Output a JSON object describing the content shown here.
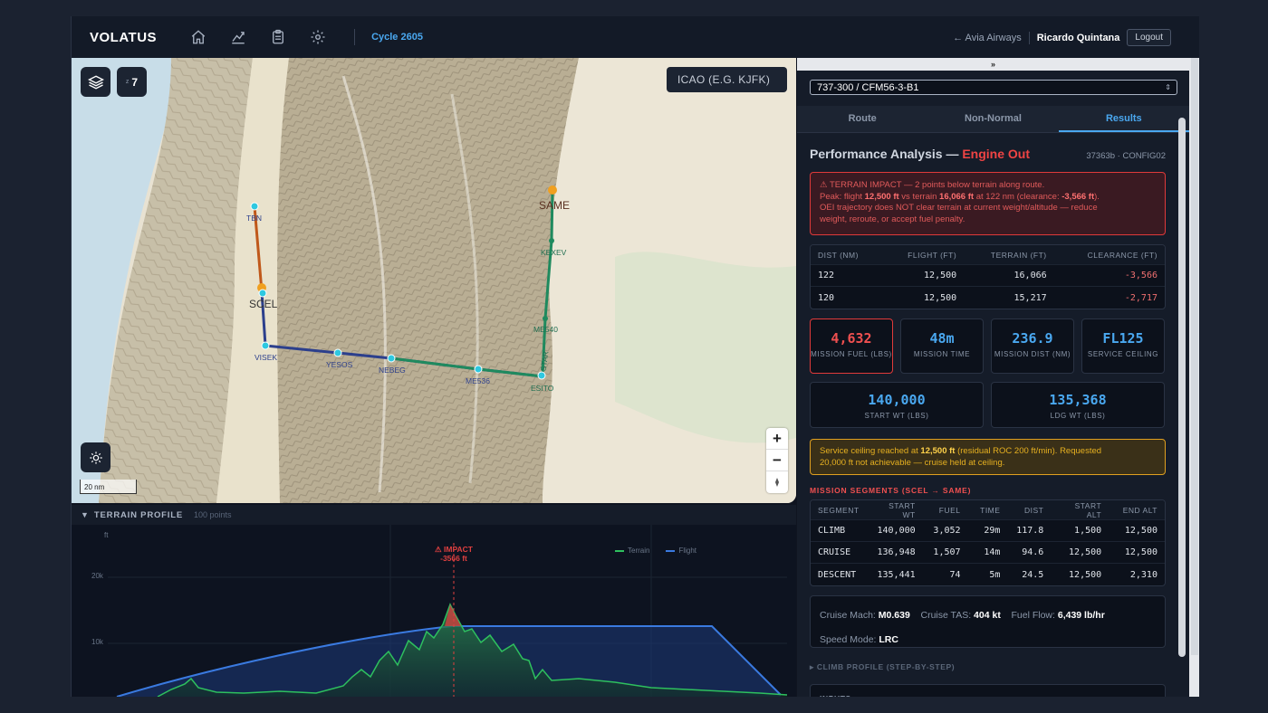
{
  "header": {
    "brand": "VOLATUS",
    "cycle": "Cycle 2605",
    "back_link": "← Avia Airways",
    "user": "Ricardo Quintana",
    "logout": "Logout",
    "nav_icons": [
      "home-icon",
      "chart-icon",
      "clipboard-icon",
      "gear-icon"
    ]
  },
  "map": {
    "zoom_prefix": "z",
    "zoom_value": "7",
    "icao_placeholder": "ICAO (E.G. KJFK)",
    "zoom_in": "+",
    "zoom_out": "−",
    "scale_label": "20 nm",
    "waypoints": [
      "TBN",
      "SCEL",
      "VISEK",
      "YESOS",
      "NEBEG",
      "ME536",
      "ESITO",
      "STAR",
      "ME540",
      "KEXEV",
      "SAME"
    ]
  },
  "profile": {
    "title": "TERRAIN PROFILE",
    "points": "100 points",
    "unit": "ft",
    "y_ticks": [
      "20k",
      "10k"
    ],
    "impact_label": "⚠ IMPACT",
    "impact_value": "-3566 ft",
    "legend_terrain": "Terrain",
    "legend_flight": "Flight"
  },
  "panel": {
    "collapse": "»",
    "aircraft": "737-300 / CFM56-3-B1",
    "tabs": [
      "Route",
      "Non-Normal",
      "Results"
    ],
    "title_main": "Performance Analysis — ",
    "title_mode": "Engine Out",
    "config_id": "37363b · CONFIG02",
    "alert": {
      "line1": "⚠ TERRAIN IMPACT — 2 points below terrain along route.",
      "line2_pre": "Peak: flight ",
      "line2_flight": "12,500 ft",
      "line2_mid": " vs terrain ",
      "line2_terrain": "16,066 ft",
      "line2_at": " at 122 nm (clearance: ",
      "line2_clear": "-3,566 ft",
      "line2_end": ").",
      "line3": "OEI trajectory does NOT clear terrain at current weight/altitude — reduce",
      "line4": "weight, reroute, or accept fuel penalty."
    },
    "impact_table": {
      "headers": [
        "DIST (NM)",
        "FLIGHT (FT)",
        "TERRAIN (FT)",
        "CLEARANCE (FT)"
      ],
      "rows": [
        [
          "122",
          "12,500",
          "16,066",
          "-3,566"
        ],
        [
          "120",
          "12,500",
          "15,217",
          "-2,717"
        ]
      ]
    },
    "cards": [
      {
        "value": "4,632",
        "label": "MISSION FUEL (LBS)"
      },
      {
        "value": "48m",
        "label": "MISSION TIME"
      },
      {
        "value": "236.9",
        "label": "MISSION DIST (NM)"
      },
      {
        "value": "FL125",
        "label": "SERVICE CEILING"
      }
    ],
    "weights": [
      {
        "value": "140,000",
        "label": "START WT (LBS)"
      },
      {
        "value": "135,368",
        "label": "LDG WT (LBS)"
      }
    ],
    "warning": {
      "pre": "Service ceiling reached at ",
      "alt": "12,500 ft",
      "post": " (residual ROC 200 ft/min). Requested",
      "line2": "20,000 ft not achievable — cruise held at ceiling."
    },
    "segments_title": "MISSION SEGMENTS (SCEL → SAME)",
    "segments": {
      "headers": [
        "SEGMENT",
        "START WT",
        "FUEL",
        "TIME",
        "DIST",
        "START ALT",
        "END ALT"
      ],
      "rows": [
        [
          "CLIMB",
          "140,000",
          "3,052",
          "29m",
          "117.8",
          "1,500",
          "12,500"
        ],
        [
          "CRUISE",
          "136,948",
          "1,507",
          "14m",
          "94.6",
          "12,500",
          "12,500"
        ],
        [
          "DESCENT",
          "135,441",
          "74",
          "5m",
          "24.5",
          "12,500",
          "2,310"
        ]
      ]
    },
    "cruise": {
      "mach_label": "Cruise Mach:",
      "mach": "M0.639",
      "tas_label": "Cruise TAS:",
      "tas": "404 kt",
      "ff_label": "Fuel Flow:",
      "ff": "6,439 lb/hr",
      "speed_label": "Speed Mode:",
      "speed": "LRC"
    },
    "climb_profile": "▸ CLIMB PROFILE (STEP-BY-STEP)",
    "inputs": "INPUTS"
  },
  "colors": {
    "accent": "#4aa8f0",
    "danger": "#f04444",
    "warning": "#e0a020",
    "route_green": "#1f8a5e",
    "route_blue": "#2c3f8c",
    "route_orange": "#c0581a"
  }
}
